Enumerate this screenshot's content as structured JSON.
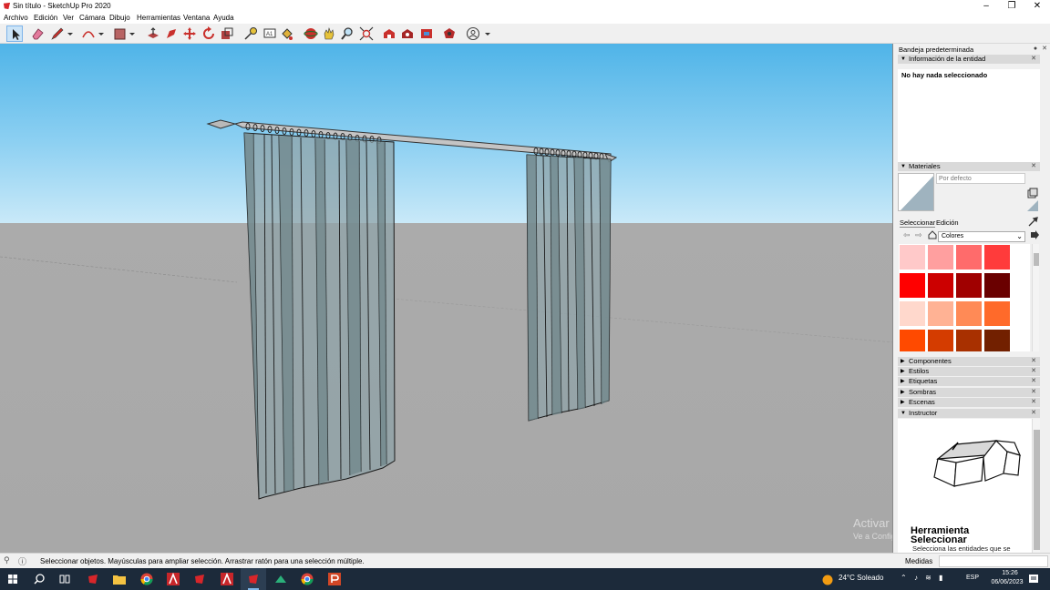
{
  "window": {
    "title": "Sin título - SketchUp Pro 2020",
    "controls": {
      "minimize": "–",
      "maximize": "❐",
      "close": "✕"
    }
  },
  "menu": [
    "Archivo",
    "Edición",
    "Ver",
    "Cámara",
    "Dibujo",
    "Herramientas",
    "Ventana",
    "Ayuda"
  ],
  "toolbar": {
    "tools": [
      "select-tool",
      "eraser-tool",
      "pencil-line-tool",
      "arc-tool",
      "rectangle-tool",
      "push-pull-tool",
      "follow-me-tool",
      "move-tool",
      "rotate-tool",
      "scale-tool",
      "tape-measure-tool",
      "text-tool",
      "paint-bucket-tool",
      "orbit-tool",
      "pan-tool",
      "zoom-tool",
      "zoom-extents-tool",
      "warehouse-tool",
      "extension-warehouse-tool",
      "send-to-layout-tool",
      "extension-manager-tool",
      "account-tool"
    ],
    "active_tool": "select-tool"
  },
  "viewport": {
    "watermark_line1": "Activar Windows",
    "watermark_line2": "Ve a Configuración para activar Windows."
  },
  "tray": {
    "title": "Bandeja predeterminada",
    "entity_info": {
      "header": "Información de la entidad",
      "empty_text": "No hay nada seleccionado"
    },
    "materials": {
      "header": "Materiales",
      "material_name": "Por defecto",
      "tab_select": "Seleccionar",
      "tab_edit": "Edición",
      "collection": "Colores",
      "swatch_colors": [
        "#ffc9c9",
        "#ff9f9f",
        "#ff6b6b",
        "#ff3b3b",
        "#ff0000",
        "#cc0000",
        "#a00000",
        "#6a0000",
        "#ffd8cc",
        "#ffb294",
        "#ff8a56",
        "#ff6a2a",
        "#ff4a00",
        "#d43c00",
        "#a83000",
        "#722000"
      ]
    },
    "collapsed_panels": [
      "Componentes",
      "Estilos",
      "Etiquetas",
      "Sombras",
      "Escenas"
    ],
    "instructor": {
      "header": "Instructor",
      "title": "Herramienta Seleccionar",
      "description": "Selecciona las entidades que se"
    }
  },
  "statusbar": {
    "text": "Seleccionar objetos. Mayúsculas para ampliar selección. Arrastrar ratón para una selección múltiple.",
    "measures_label": "Medidas",
    "measures_value": ""
  },
  "taskbar": {
    "weather": "24°C Soleado",
    "language": "ESP",
    "time": "15:26",
    "date": "06/06/2023"
  }
}
